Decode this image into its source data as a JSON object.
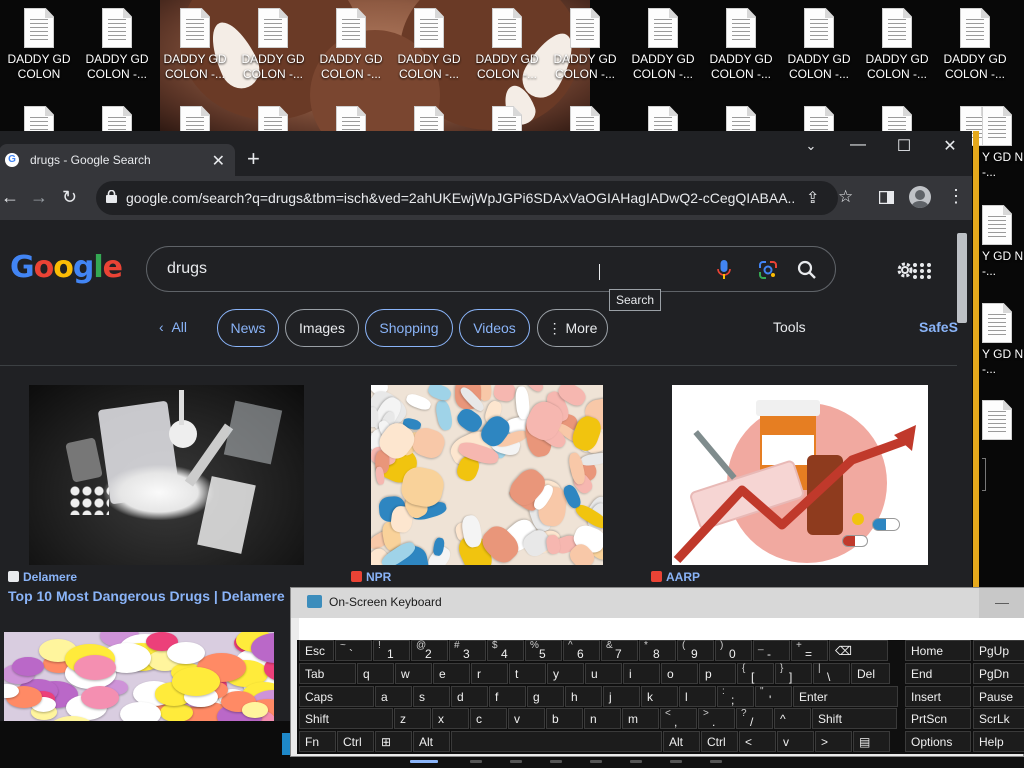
{
  "desktop": {
    "icon_label_first": "DADDY GD COLON",
    "icon_label": "DADDY GD COLON -...",
    "side_icon_label": "Y GD N -..."
  },
  "browser": {
    "tab_title": "drugs - Google Search",
    "favicon": "G",
    "url": "google.com/search?q=drugs&tbm=isch&ved=2ahUKEwjWpJGPi6SDAxVaOGIAHagIADwQ2-cCegQIABAA...",
    "icons": [
      "back-icon",
      "forward-icon",
      "reload-icon",
      "lock-icon",
      "share-icon",
      "star-icon",
      "side-panel-icon",
      "profile-icon",
      "menu-icon"
    ]
  },
  "google": {
    "logo_letters": [
      "G",
      "o",
      "o",
      "g",
      "l",
      "e"
    ],
    "logo_colors": [
      "#4285f4",
      "#ea4335",
      "#fbbc05",
      "#4285f4",
      "#34a853",
      "#ea4335"
    ],
    "query": "drugs",
    "search_tooltip": "Search",
    "chips": {
      "all": "All",
      "news": "News",
      "images": "Images",
      "shopping": "Shopping",
      "videos": "Videos",
      "more": "More",
      "tools": "Tools",
      "safesearch": "SafeS"
    },
    "results": [
      {
        "source": "Delamere",
        "title": "Top 10 Most Dangerous Drugs | Delamere",
        "fav_color": "#e8eaed"
      },
      {
        "source": "NPR",
        "title": "",
        "fav_color": "#ea4335"
      },
      {
        "source": "AARP",
        "title": "",
        "fav_color": "#ea4335"
      }
    ]
  },
  "osk": {
    "title": "On-Screen Keyboard",
    "min_glyph": "—",
    "row1": [
      {
        "k": "Esc"
      },
      {
        "s": "~",
        "b": "`"
      },
      {
        "s": "!",
        "b": "1"
      },
      {
        "s": "@",
        "b": "2"
      },
      {
        "s": "#",
        "b": "3"
      },
      {
        "s": "$",
        "b": "4"
      },
      {
        "s": "%",
        "b": "5"
      },
      {
        "s": "^",
        "b": "6"
      },
      {
        "s": "&",
        "b": "7"
      },
      {
        "s": "*",
        "b": "8"
      },
      {
        "s": "(",
        "b": "9"
      },
      {
        "s": ")",
        "b": "0"
      },
      {
        "s": "_",
        "b": "-"
      },
      {
        "s": "+",
        "b": "="
      },
      {
        "k": "⌫"
      }
    ],
    "row2": [
      {
        "k": "Tab"
      },
      {
        "k": "q"
      },
      {
        "k": "w"
      },
      {
        "k": "e"
      },
      {
        "k": "r"
      },
      {
        "k": "t"
      },
      {
        "k": "y"
      },
      {
        "k": "u"
      },
      {
        "k": "i"
      },
      {
        "k": "o"
      },
      {
        "k": "p"
      },
      {
        "s": "{",
        "b": "["
      },
      {
        "s": "}",
        "b": "]"
      },
      {
        "s": "|",
        "b": "\\"
      },
      {
        "k": "Del"
      }
    ],
    "row3": [
      {
        "k": "Caps"
      },
      {
        "k": "a"
      },
      {
        "k": "s"
      },
      {
        "k": "d"
      },
      {
        "k": "f"
      },
      {
        "k": "g"
      },
      {
        "k": "h"
      },
      {
        "k": "j"
      },
      {
        "k": "k"
      },
      {
        "k": "l"
      },
      {
        "s": ":",
        "b": ";"
      },
      {
        "s": "\"",
        "b": "'"
      },
      {
        "k": "Enter"
      }
    ],
    "row4": [
      {
        "k": "Shift"
      },
      {
        "k": "z"
      },
      {
        "k": "x"
      },
      {
        "k": "c"
      },
      {
        "k": "v"
      },
      {
        "k": "b"
      },
      {
        "k": "n"
      },
      {
        "k": "m"
      },
      {
        "s": "<",
        "b": ","
      },
      {
        "s": ">",
        "b": "."
      },
      {
        "s": "?",
        "b": "/"
      },
      {
        "k": "^"
      },
      {
        "k": "Shift"
      }
    ],
    "row5": [
      {
        "k": "Fn"
      },
      {
        "k": "Ctrl"
      },
      {
        "k": "⊞"
      },
      {
        "k": "Alt"
      },
      {
        "k": ""
      },
      {
        "k": "Alt"
      },
      {
        "k": "Ctrl"
      },
      {
        "k": "<"
      },
      {
        "k": "v"
      },
      {
        "k": ">"
      },
      {
        "k": "▤"
      }
    ],
    "nav": [
      [
        "Home",
        "PgUp"
      ],
      [
        "End",
        "PgDn"
      ],
      [
        "Insert",
        "Pause"
      ],
      [
        "PrtScn",
        "ScrLk"
      ],
      [
        "Options",
        "Help"
      ]
    ]
  }
}
